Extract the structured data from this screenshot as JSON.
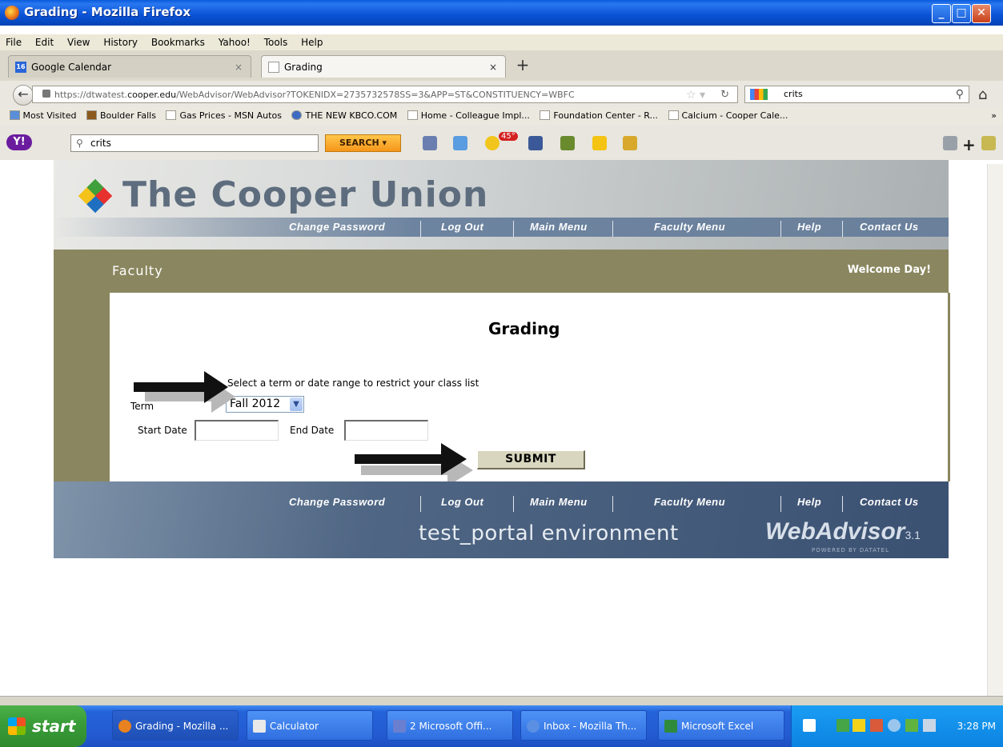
{
  "window": {
    "title": "Grading - Mozilla Firefox",
    "min": "_",
    "max": "□",
    "close": "✕"
  },
  "menu": [
    "File",
    "Edit",
    "View",
    "History",
    "Bookmarks",
    "Yahoo!",
    "Tools",
    "Help"
  ],
  "tabs": [
    {
      "label": "Google Calendar",
      "icon": "calendar-icon",
      "icon_text": "16"
    },
    {
      "label": "Grading",
      "icon": "page-icon"
    }
  ],
  "tab_close": "×",
  "new_tab": "+",
  "url": {
    "prefix": "https://dtwatest.",
    "host": "cooper.edu",
    "path": "/WebAdvisor/WebAdvisor?TOKENIDX=2735732578SS=3&APP=ST&CONSTITUENCY=WBFC"
  },
  "browser_search": "crits",
  "bookmarks": [
    "Most Visited",
    "Boulder Falls",
    "Gas Prices - MSN Autos",
    "THE NEW KBCO.COM",
    "Home - Colleague Impl...",
    "Foundation Center - R...",
    "Calcium - Cooper Cale..."
  ],
  "bookmarks_more": "»",
  "yahoo": {
    "logo": "Y!",
    "search_value": "crits",
    "search_button": "SEARCH",
    "badge": "45°"
  },
  "site": {
    "brand": "The Cooper Union",
    "nav": [
      "Change Password",
      "Log Out",
      "Main Menu",
      "Faculty Menu",
      "Help",
      "Contact Us"
    ],
    "section": "Faculty",
    "welcome": "Welcome Day!"
  },
  "form": {
    "title": "Grading",
    "instruction": "Select a term or date range to restrict your class list",
    "term_label": "Term",
    "term_value": "Fall 2012",
    "start_label": "Start Date",
    "end_label": "End Date",
    "start_value": "",
    "end_value": "",
    "submit_label": "SUBMIT"
  },
  "footer": {
    "env": "test_portal environment",
    "product": "WebAdvisor",
    "version": "3.1",
    "powered": "POWERED BY DATATEL"
  },
  "taskbar": {
    "start": "start",
    "items": [
      "Grading - Mozilla ...",
      "Calculator",
      "2 Microsoft Offi...",
      "Inbox - Mozilla Th...",
      "Microsoft Excel"
    ],
    "clock": "3:28 PM"
  },
  "colors": {
    "olive": "#8a8760",
    "nav_blue": "#6d84a0",
    "submit_bg": "#d9d6bf"
  }
}
